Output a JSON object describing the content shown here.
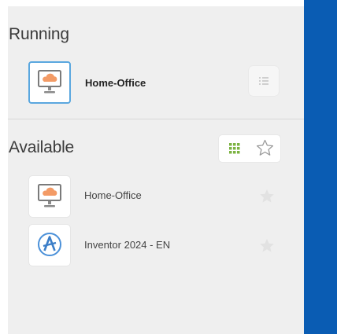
{
  "sections": {
    "running": {
      "title": "Running",
      "items": [
        {
          "label": "Home-Office",
          "icon": "monitor-cloud-icon"
        }
      ]
    },
    "available": {
      "title": "Available",
      "items": [
        {
          "label": "Home-Office",
          "icon": "monitor-cloud-icon"
        },
        {
          "label": "Inventor 2024 - EN",
          "icon": "autodesk-inventor-icon"
        }
      ]
    }
  },
  "colors": {
    "accent": "#5aa7df",
    "grid_icon": "#7cb342",
    "sidebar_bg": "#efefef",
    "right_panel": "#0a5cb3",
    "cloud": "#f39b66"
  }
}
